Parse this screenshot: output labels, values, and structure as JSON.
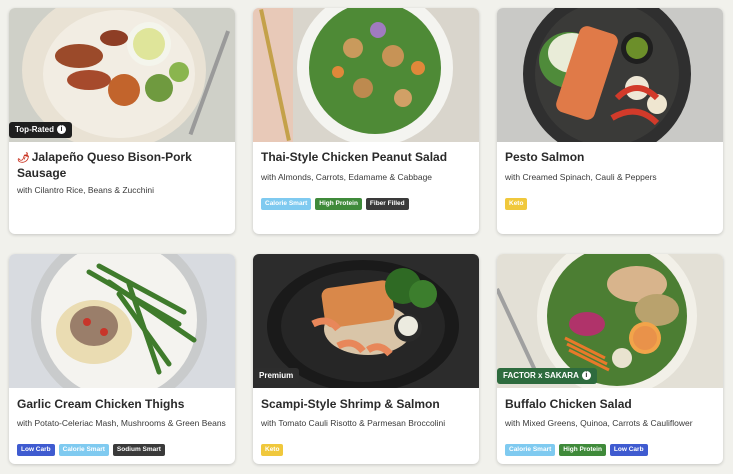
{
  "colors": {
    "calorie_smart": "#7fcaf0",
    "high_protein": "#3f8a3a",
    "fiber_filled": "#3a3a3a",
    "keto": "#f0c83c",
    "low_carb": "#3f5bd0",
    "sodium_smart": "#3a3a3a",
    "top_rated_flag": "#1f1f1f",
    "premium_flag": "#2d2d2d",
    "sakara_flag": "#2e6b3e"
  },
  "cards": [
    {
      "flag": "Top-Rated",
      "flag_icon": "info-icon",
      "title_icon": "chili-pepper-icon",
      "title": "Jalapeño Queso Bison-Pork Sausage",
      "subtitle": "with Cilantro Rice, Beans & Zucchini",
      "tags": []
    },
    {
      "title": "Thai-Style Chicken Peanut Salad",
      "subtitle": "with Almonds, Carrots, Edamame & Cabbage",
      "tags": [
        "Calorie Smart",
        "High Protein",
        "Fiber Filled"
      ]
    },
    {
      "title": "Pesto Salmon",
      "subtitle": "with Creamed Spinach, Cauli & Peppers",
      "tags": [
        "Keto"
      ]
    },
    {
      "title": "Garlic Cream Chicken Thighs",
      "subtitle": "with Potato-Celeriac Mash, Mushrooms & Green Beans",
      "tags": [
        "Low Carb",
        "Calorie Smart",
        "Sodium Smart"
      ]
    },
    {
      "flag": "Premium",
      "title": "Scampi-Style Shrimp & Salmon",
      "subtitle": "with Tomato Cauli Risotto & Parmesan Broccolini",
      "tags": [
        "Keto"
      ]
    },
    {
      "flag": "FACTOR x SAKARA",
      "flag_icon": "info-icon",
      "title": "Buffalo Chicken Salad",
      "subtitle": "with Mixed Greens, Quinoa, Carrots & Cauliflower",
      "tags": [
        "Calorie Smart",
        "High Protein",
        "Low Carb"
      ]
    }
  ]
}
